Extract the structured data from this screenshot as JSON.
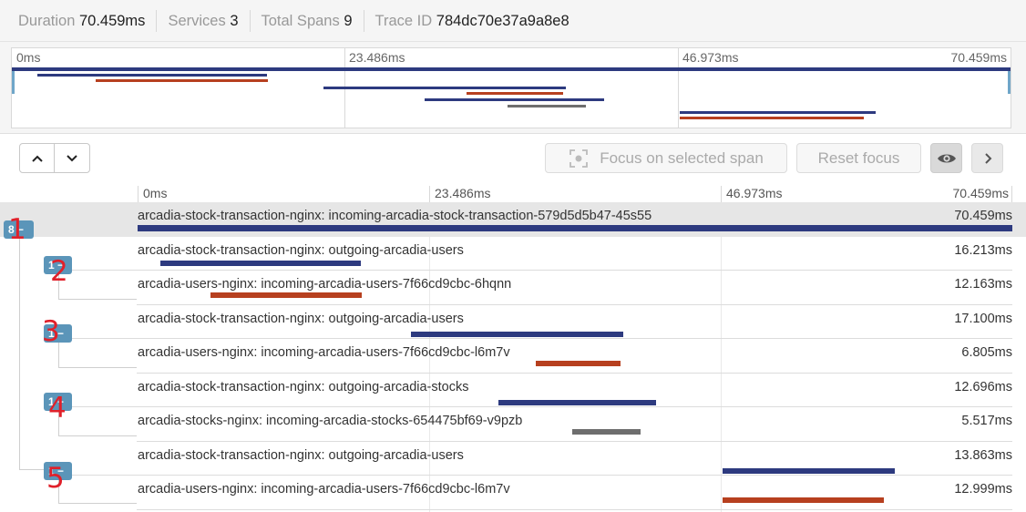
{
  "summary": {
    "duration_label": "Duration",
    "duration_value": "70.459ms",
    "services_label": "Services",
    "services_value": "3",
    "spans_label": "Total Spans",
    "spans_value": "9",
    "trace_label": "Trace ID",
    "trace_value": "784dc70e37a9a8e8"
  },
  "timeline": {
    "ticks": [
      "0ms",
      "23.486ms",
      "46.973ms",
      "70.459ms"
    ]
  },
  "toolbar": {
    "focus_label": "Focus on selected span",
    "reset_label": "Reset focus"
  },
  "colors": {
    "frontend": "#2d3a7f",
    "users": "#b7401f",
    "stocks": "#6e6e6e",
    "badge": "#5b95b9",
    "annotation": "#e0202a"
  },
  "badges": [
    {
      "label": "8 −"
    },
    {
      "label": "1 −"
    },
    {
      "label": "1 −"
    },
    {
      "label": "1 −"
    },
    {
      "label": "1 −"
    }
  ],
  "annotations": [
    "1",
    "2",
    "3",
    "4",
    "5"
  ],
  "spans": [
    {
      "name": "arcadia-stock-transaction-nginx: incoming-arcadia-stock-transaction-579d5d5b47-45s55",
      "duration": "70.459ms",
      "start_ms": 0,
      "duration_ms": 70.459,
      "service": "frontend"
    },
    {
      "name": "arcadia-stock-transaction-nginx: outgoing-arcadia-users",
      "duration": "16.213ms",
      "start_ms": 1.8,
      "duration_ms": 16.213,
      "service": "frontend"
    },
    {
      "name": "arcadia-users-nginx: incoming-arcadia-users-7f66cd9cbc-6hqnn",
      "duration": "12.163ms",
      "start_ms": 5.9,
      "duration_ms": 12.163,
      "service": "users"
    },
    {
      "name": "arcadia-stock-transaction-nginx: outgoing-arcadia-users",
      "duration": "17.100ms",
      "start_ms": 22.0,
      "duration_ms": 17.1,
      "service": "frontend"
    },
    {
      "name": "arcadia-users-nginx: incoming-arcadia-users-7f66cd9cbc-l6m7v",
      "duration": "6.805ms",
      "start_ms": 32.1,
      "duration_ms": 6.805,
      "service": "users"
    },
    {
      "name": "arcadia-stock-transaction-nginx: outgoing-arcadia-stocks",
      "duration": "12.696ms",
      "start_ms": 29.1,
      "duration_ms": 12.696,
      "service": "frontend"
    },
    {
      "name": "arcadia-stocks-nginx: incoming-arcadia-stocks-654475bf69-v9pzb",
      "duration": "5.517ms",
      "start_ms": 35.0,
      "duration_ms": 5.517,
      "service": "stocks"
    },
    {
      "name": "arcadia-stock-transaction-nginx: outgoing-arcadia-users",
      "duration": "13.863ms",
      "start_ms": 47.1,
      "duration_ms": 13.863,
      "service": "frontend"
    },
    {
      "name": "arcadia-users-nginx: incoming-arcadia-users-7f66cd9cbc-l6m7v",
      "duration": "12.999ms",
      "start_ms": 47.1,
      "duration_ms": 12.999,
      "service": "users"
    }
  ]
}
